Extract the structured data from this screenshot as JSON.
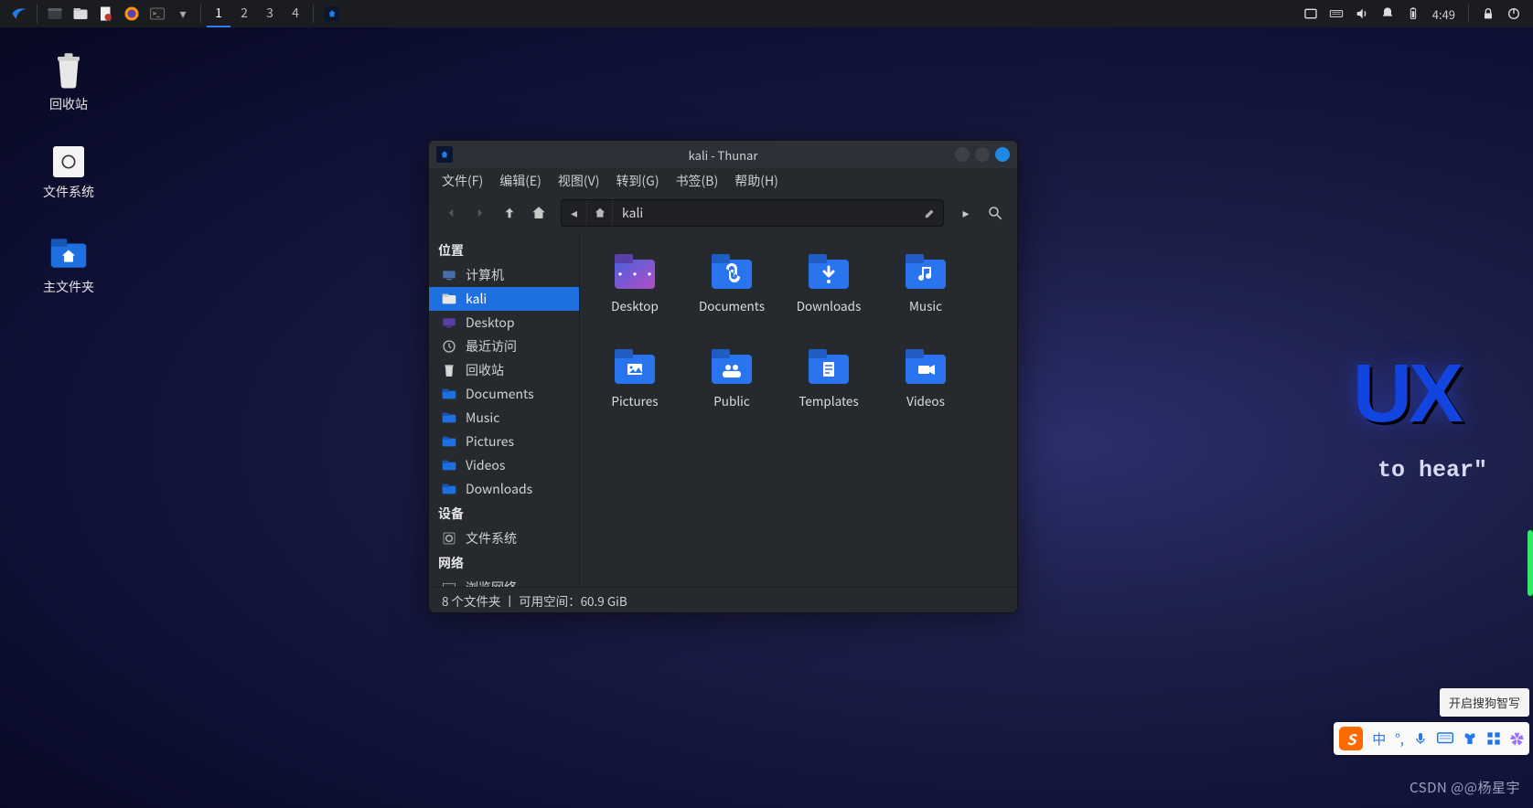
{
  "panel": {
    "workspaces": [
      "1",
      "2",
      "3",
      "4"
    ],
    "active_workspace": 0,
    "clock": "4:49"
  },
  "desktop_icons": [
    {
      "id": "trash",
      "label": "回收站"
    },
    {
      "id": "filesystem",
      "label": "文件系统"
    },
    {
      "id": "home",
      "label": "主文件夹"
    }
  ],
  "wallpaper": {
    "logo_fragment": "UX",
    "slogan_fragment": "to hear\""
  },
  "window": {
    "title": "kali - Thunar",
    "menu": [
      "文件(F)",
      "编辑(E)",
      "视图(V)",
      "转到(G)",
      "书签(B)",
      "帮助(H)"
    ],
    "path_label": "kali",
    "sidebar": {
      "places": {
        "header": "位置",
        "items": [
          {
            "id": "computer",
            "label": "计算机"
          },
          {
            "id": "kali",
            "label": "kali",
            "selected": true
          },
          {
            "id": "desktop",
            "label": "Desktop"
          },
          {
            "id": "recent",
            "label": "最近访问"
          },
          {
            "id": "trash",
            "label": "回收站"
          },
          {
            "id": "documents",
            "label": "Documents"
          },
          {
            "id": "music",
            "label": "Music"
          },
          {
            "id": "pictures",
            "label": "Pictures"
          },
          {
            "id": "videos",
            "label": "Videos"
          },
          {
            "id": "downloads",
            "label": "Downloads"
          }
        ]
      },
      "devices": {
        "header": "设备",
        "items": [
          {
            "id": "fs",
            "label": "文件系统"
          }
        ]
      },
      "network": {
        "header": "网络",
        "items": [
          {
            "id": "browse",
            "label": "浏览网络"
          }
        ]
      }
    },
    "folders": [
      {
        "id": "desktop",
        "label": "Desktop",
        "icon": "desktop"
      },
      {
        "id": "documents",
        "label": "Documents",
        "icon": "attach"
      },
      {
        "id": "downloads",
        "label": "Downloads",
        "icon": "download"
      },
      {
        "id": "music",
        "label": "Music",
        "icon": "music"
      },
      {
        "id": "pictures",
        "label": "Pictures",
        "icon": "picture"
      },
      {
        "id": "public",
        "label": "Public",
        "icon": "public"
      },
      {
        "id": "templates",
        "label": "Templates",
        "icon": "template"
      },
      {
        "id": "videos",
        "label": "Videos",
        "icon": "video"
      }
    ],
    "status": "8 个文件夹 丨 可用空间：60.9 GiB"
  },
  "ime": {
    "tip": "开启搜狗智写",
    "logo": "S",
    "mode": "中"
  },
  "watermark": "CSDN @@杨星宇"
}
